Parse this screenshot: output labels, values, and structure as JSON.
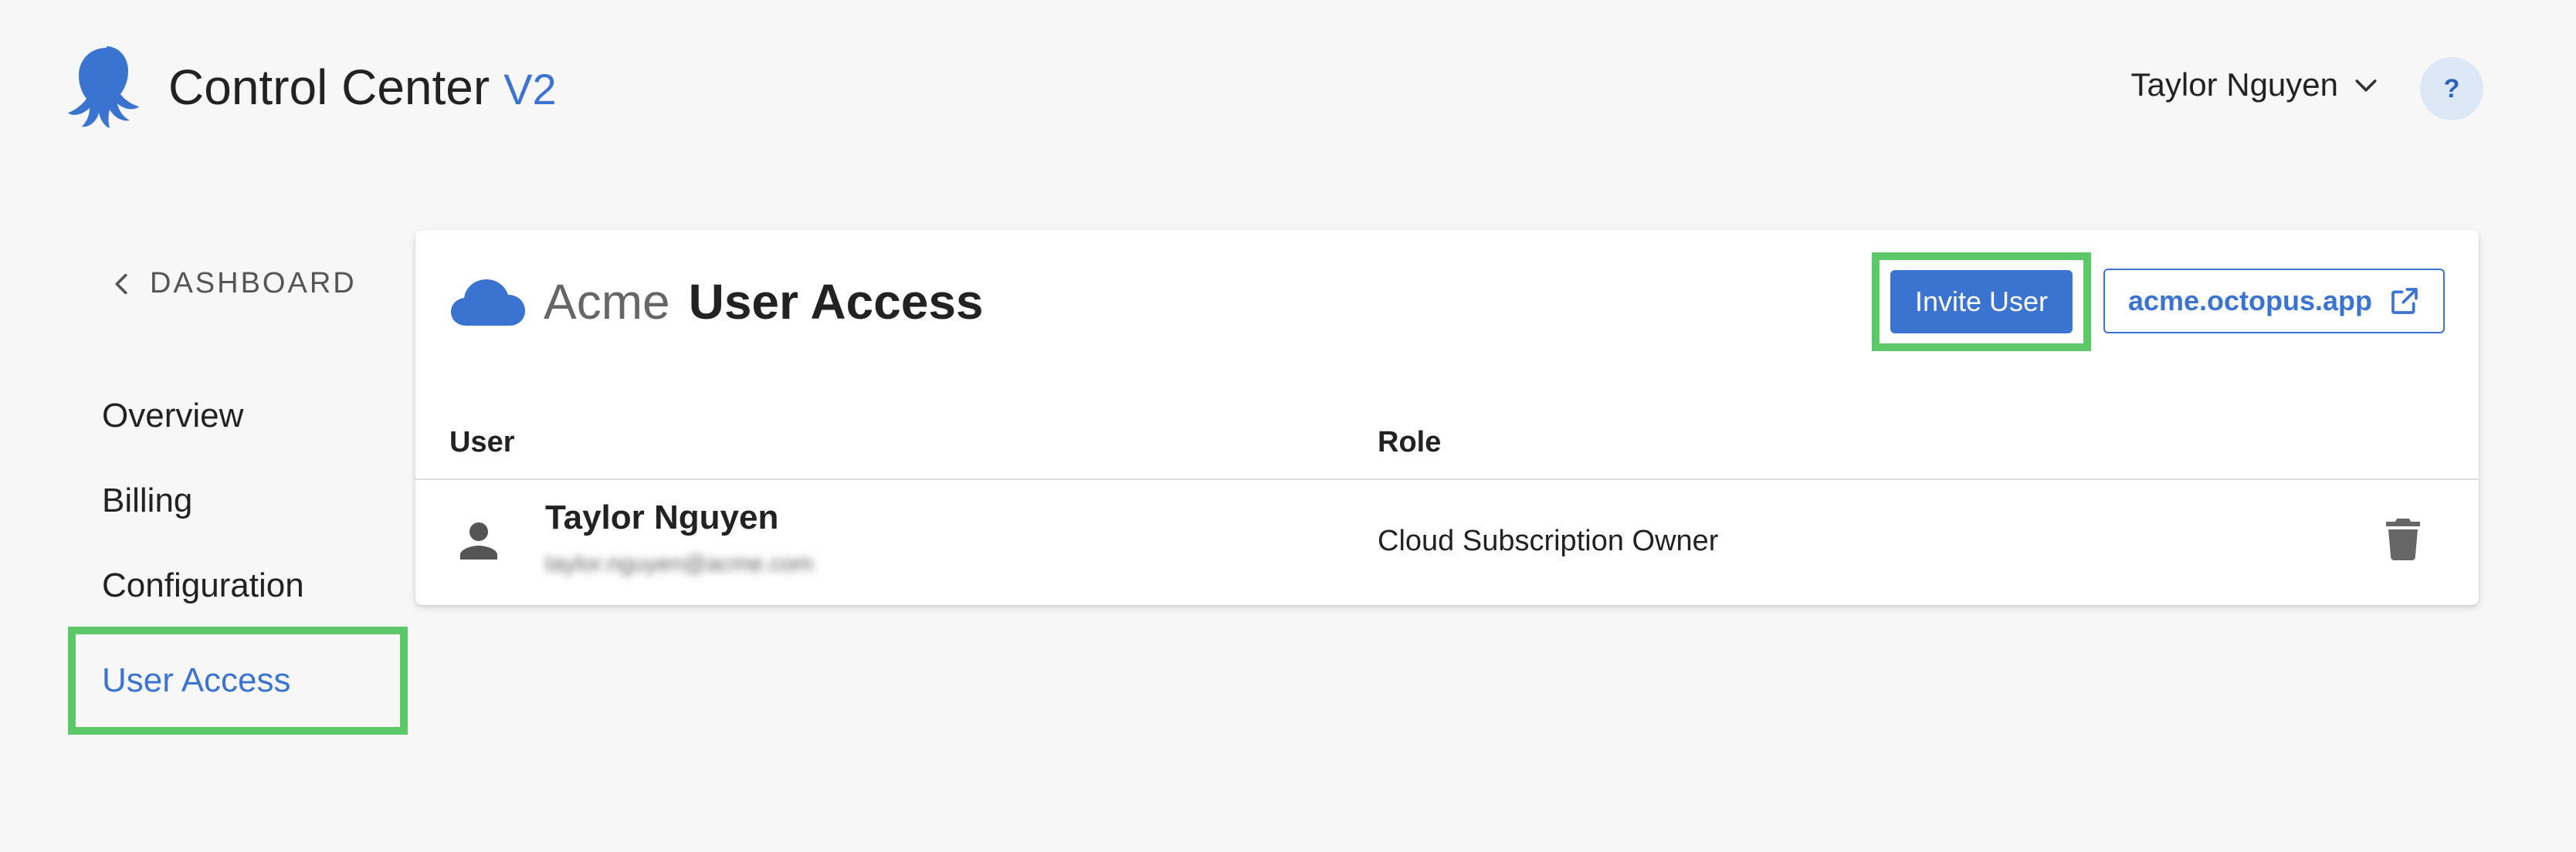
{
  "header": {
    "app_name": "Control Center",
    "version": "V2",
    "user_menu_label": "Taylor Nguyen",
    "help_label": "?"
  },
  "sidebar": {
    "back_label": "DASHBOARD",
    "items": [
      {
        "label": "Overview"
      },
      {
        "label": "Billing"
      },
      {
        "label": "Configuration"
      },
      {
        "label": "User Access",
        "active": true
      }
    ]
  },
  "main": {
    "org_name": "Acme",
    "title": "User Access",
    "invite_button_label": "Invite User",
    "external_link_label": "acme.octopus.app",
    "table": {
      "columns": [
        "User",
        "Role"
      ],
      "rows": [
        {
          "name": "Taylor Nguyen",
          "email": "taylor.nguyen@acme.com",
          "role": "Cloud Subscription Owner"
        }
      ]
    }
  },
  "colors": {
    "accent": "#3b73d0",
    "highlight": "#5dc86a",
    "background": "#f7f7f7"
  },
  "icons": [
    "octopus-logo-icon",
    "chevron-down-icon",
    "chevron-left-icon",
    "cloud-icon",
    "external-link-icon",
    "person-icon",
    "trash-icon"
  ]
}
